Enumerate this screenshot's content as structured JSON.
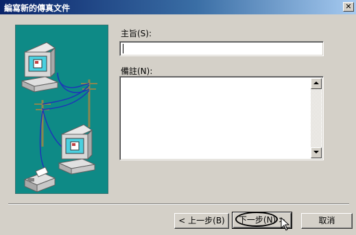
{
  "dialog": {
    "title": "編寫新的傳真文件",
    "close_label": "✕"
  },
  "form": {
    "subject_label": "主旨(S):",
    "subject_value": "",
    "note_label": "備註(N):",
    "note_value": ""
  },
  "buttons": {
    "back_label": "< 上一步(B)",
    "next_label": "下一步(N) >",
    "cancel_label": "取消"
  },
  "illustration": {
    "colors": {
      "background": "#0e8a86",
      "computer_screen": "#4ad0e0",
      "cable": "#1d36b8",
      "pole": "#c8c080"
    }
  }
}
